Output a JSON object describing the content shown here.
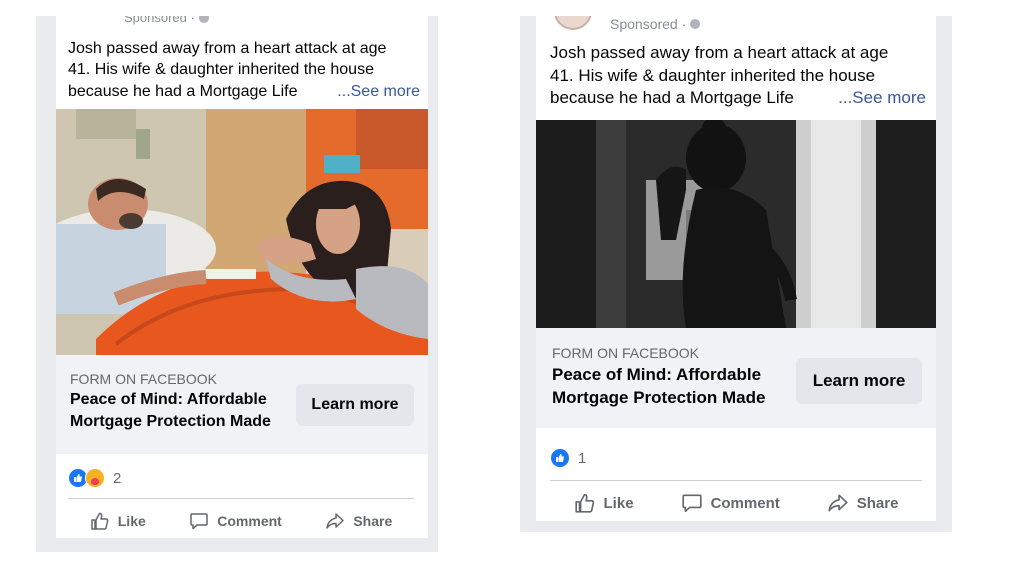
{
  "posts": [
    {
      "sponsored": "Sponsored ·",
      "text_lines": [
        "Josh passed away from a heart attack at age",
        "41. His wife & daughter inherited the house",
        "because he had a Mortgage Life"
      ],
      "see_more": "...See more",
      "photo_icon": "hospital-bed-photo",
      "cta_source": "FORM ON FACEBOOK",
      "cta_title_lines": [
        "Peace of Mind: Affordable",
        "Mortgage Protection Made"
      ],
      "learn_more": "Learn more",
      "reaction_count": "2",
      "actions": {
        "like": "Like",
        "comment": "Comment",
        "share": "Share"
      }
    },
    {
      "sponsored": "Sponsored ·",
      "text_lines": [
        "Josh passed away from a heart attack at age",
        "41. His wife & daughter inherited the house",
        "because he had a Mortgage Life"
      ],
      "see_more": "...See more",
      "photo_icon": "grieving-woman-photo",
      "cta_source": "FORM ON FACEBOOK",
      "cta_title_lines": [
        "Peace of Mind: Affordable",
        "Mortgage Protection Made"
      ],
      "learn_more": "Learn more",
      "reaction_count": "1",
      "actions": {
        "like": "Like",
        "comment": "Comment",
        "share": "Share"
      }
    }
  ],
  "colors": {
    "facebook_blue": "#1877f2",
    "link_blue": "#385898",
    "secondary_text": "#65676b",
    "button_gray": "#e4e6eb",
    "cta_background": "#f0f2f5"
  }
}
